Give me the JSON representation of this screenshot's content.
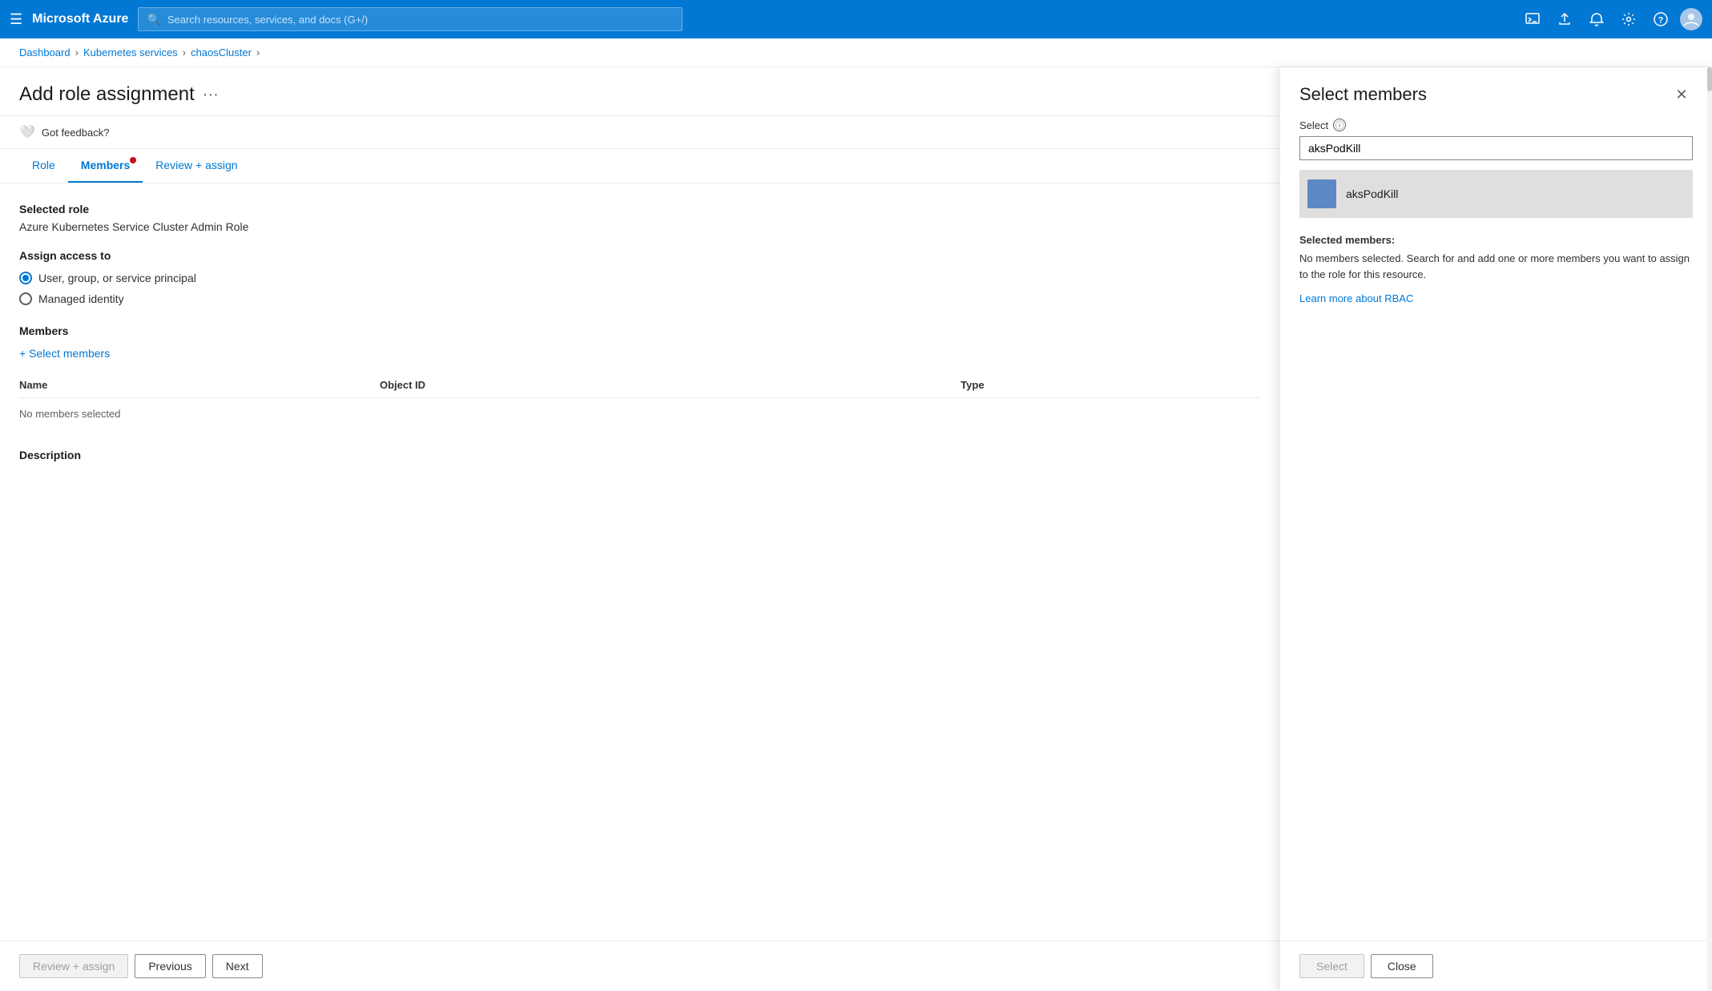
{
  "nav": {
    "hamburger": "☰",
    "brand": "Microsoft Azure",
    "search_placeholder": "Search resources, services, and docs (G+/)",
    "icons": [
      "terminal",
      "cloud-upload",
      "bell",
      "settings",
      "question",
      "user"
    ]
  },
  "breadcrumb": {
    "items": [
      "Dashboard",
      "Kubernetes services",
      "chaosCluster"
    ],
    "separator": "›"
  },
  "page": {
    "title": "Add role assignment",
    "more_icon": "···"
  },
  "feedback": {
    "label": "Got feedback?"
  },
  "tabs": [
    {
      "id": "role",
      "label": "Role",
      "active": false,
      "dot": false
    },
    {
      "id": "members",
      "label": "Members",
      "active": true,
      "dot": true
    },
    {
      "id": "review",
      "label": "Review + assign",
      "active": false,
      "dot": false
    }
  ],
  "form": {
    "selected_role_label": "Selected role",
    "selected_role_value": "Azure Kubernetes Service Cluster Admin Role",
    "assign_access_label": "Assign access to",
    "access_options": [
      {
        "id": "user_group",
        "label": "User, group, or service principal",
        "selected": true
      },
      {
        "id": "managed_identity",
        "label": "Managed identity",
        "selected": false
      }
    ],
    "members_section_label": "Members",
    "select_members_link": "+ Select members",
    "table": {
      "columns": [
        "Name",
        "Object ID",
        "Type"
      ],
      "empty_text": "No members selected"
    },
    "description_label": "Description"
  },
  "bottom_bar": {
    "review_assign": "Review + assign",
    "previous": "Previous",
    "next": "Next"
  },
  "select_panel": {
    "title": "Select members",
    "close_icon": "✕",
    "select_label": "Select",
    "search_value": "aksPodKill",
    "search_placeholder": "",
    "result": {
      "name": "aksPodKill"
    },
    "selected_members_title": "Selected members:",
    "selected_members_desc": "No members selected. Search for and add one or more members you want to assign to the role for this resource.",
    "rbac_link": "Learn more about RBAC",
    "select_button": "Select",
    "close_button": "Close"
  }
}
